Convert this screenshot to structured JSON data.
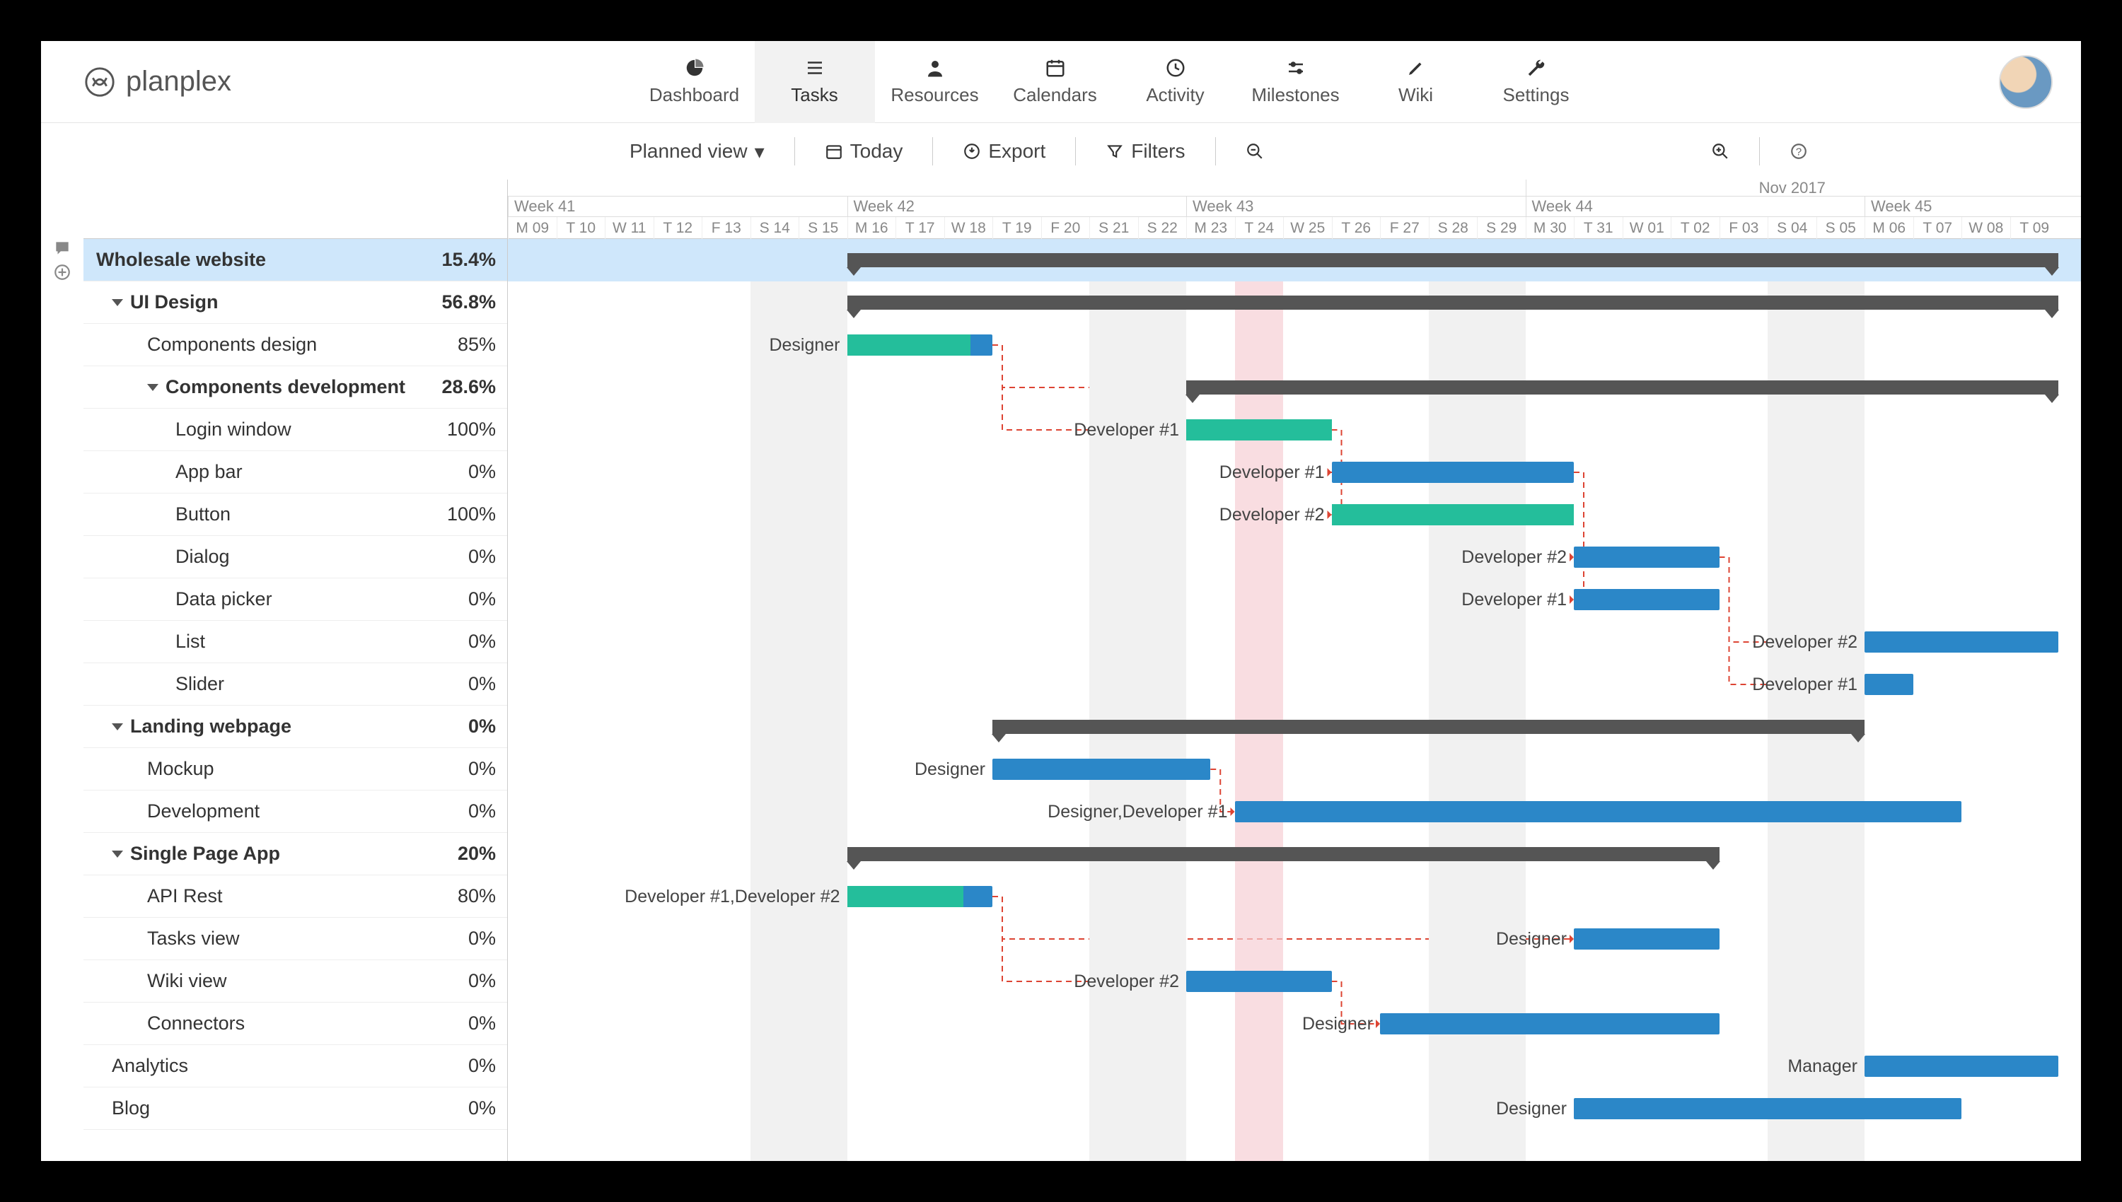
{
  "brand": {
    "name": "planplex"
  },
  "nav": {
    "items": [
      {
        "id": "dashboard",
        "label": "Dashboard",
        "icon": "pie"
      },
      {
        "id": "tasks",
        "label": "Tasks",
        "icon": "list",
        "active": true
      },
      {
        "id": "resources",
        "label": "Resources",
        "icon": "user"
      },
      {
        "id": "calendars",
        "label": "Calendars",
        "icon": "calendar"
      },
      {
        "id": "activity",
        "label": "Activity",
        "icon": "clock"
      },
      {
        "id": "milestones",
        "label": "Milestones",
        "icon": "slider"
      },
      {
        "id": "wiki",
        "label": "Wiki",
        "icon": "pencil"
      },
      {
        "id": "settings",
        "label": "Settings",
        "icon": "wrench"
      }
    ]
  },
  "toolbar": {
    "view_label": "Planned view",
    "today": "Today",
    "export": "Export",
    "filters": "Filters"
  },
  "timeline": {
    "month_right_label": "Nov 2017",
    "month_split": 21,
    "day_width": 68.5,
    "days": [
      "M 09",
      "T 10",
      "W 11",
      "T 12",
      "F 13",
      "S 14",
      "S 15",
      "M 16",
      "T 17",
      "W 18",
      "T 19",
      "F 20",
      "S 21",
      "S 22",
      "M 23",
      "T 24",
      "W 25",
      "T 26",
      "F 27",
      "S 28",
      "S 29",
      "M 30",
      "T 31",
      "W 01",
      "T 02",
      "F 03",
      "S 04",
      "S 05",
      "M 06",
      "T 07",
      "W 08",
      "T 09"
    ],
    "weeks": [
      {
        "label": "Week 41",
        "start": 0
      },
      {
        "label": "Week 42",
        "start": 7
      },
      {
        "label": "Week 43",
        "start": 14
      },
      {
        "label": "Week 44",
        "start": 21
      },
      {
        "label": "Week 45",
        "start": 28
      }
    ],
    "weekend_starts": [
      5,
      12,
      19,
      26
    ],
    "today_index": 15
  },
  "rows": [
    {
      "id": "wholesale",
      "name": "Wholesale website",
      "pct": "15.4%",
      "level": 0,
      "bold": true,
      "selected": true,
      "flag": "",
      "summary": {
        "start": 7,
        "end": 32
      }
    },
    {
      "id": "uidesign",
      "name": "UI Design",
      "pct": "56.8%",
      "level": 1,
      "bold": true,
      "caret": true,
      "summary": {
        "start": 7,
        "end": 32
      }
    },
    {
      "id": "compdes",
      "name": "Components design",
      "pct": "85%",
      "level": 2,
      "flag": "pink",
      "assignee": "Designer",
      "bar": {
        "start": 7,
        "end": 10,
        "progress": 85
      }
    },
    {
      "id": "compdev",
      "name": "Components development",
      "pct": "28.6%",
      "level": 2,
      "bold": true,
      "caret": true,
      "summary": {
        "start": 14,
        "end": 32
      }
    },
    {
      "id": "login",
      "name": "Login window",
      "pct": "100%",
      "level": 3,
      "flag": "green",
      "assignee": "Developer #1",
      "bar": {
        "start": 14,
        "end": 17,
        "progress": 100
      }
    },
    {
      "id": "appbar",
      "name": "App bar",
      "pct": "0%",
      "level": 3,
      "assignee": "Developer #1",
      "bar": {
        "start": 17,
        "end": 22,
        "progress": 0
      }
    },
    {
      "id": "button",
      "name": "Button",
      "pct": "100%",
      "level": 3,
      "flag": "green",
      "assignee": "Developer #2",
      "bar": {
        "start": 17,
        "end": 22,
        "progress": 100
      }
    },
    {
      "id": "dialog",
      "name": "Dialog",
      "pct": "0%",
      "level": 3,
      "assignee": "Developer #2",
      "bar": {
        "start": 22,
        "end": 25,
        "progress": 0
      }
    },
    {
      "id": "datapick",
      "name": "Data picker",
      "pct": "0%",
      "level": 3,
      "assignee": "Developer #1",
      "bar": {
        "start": 22,
        "end": 25,
        "progress": 0
      }
    },
    {
      "id": "list",
      "name": "List",
      "pct": "0%",
      "level": 3,
      "assignee": "Developer #2",
      "bar": {
        "start": 28,
        "end": 32,
        "progress": 0
      }
    },
    {
      "id": "slider",
      "name": "Slider",
      "pct": "0%",
      "level": 3,
      "assignee": "Developer #1",
      "bar": {
        "start": 28,
        "end": 29,
        "progress": 0
      }
    },
    {
      "id": "landing",
      "name": "Landing webpage",
      "pct": "0%",
      "level": 1,
      "bold": true,
      "caret": true,
      "summary": {
        "start": 10,
        "end": 28
      }
    },
    {
      "id": "mockup",
      "name": "Mockup",
      "pct": "0%",
      "level": 2,
      "assignee": "Designer",
      "bar": {
        "start": 10,
        "end": 14.5,
        "progress": 0
      }
    },
    {
      "id": "devland",
      "name": "Development",
      "pct": "0%",
      "level": 2,
      "assignee": "Designer,Developer #1",
      "bar": {
        "start": 15,
        "end": 30,
        "progress": 0
      }
    },
    {
      "id": "spa",
      "name": "Single Page App",
      "pct": "20%",
      "level": 1,
      "bold": true,
      "caret": true,
      "summary": {
        "start": 7,
        "end": 25
      }
    },
    {
      "id": "apirest",
      "name": "API Rest",
      "pct": "80%",
      "level": 2,
      "flag": "pink",
      "assignee": "Developer #1,Developer #2",
      "bar": {
        "start": 7,
        "end": 10,
        "progress": 80
      }
    },
    {
      "id": "tasksview",
      "name": "Tasks view",
      "pct": "0%",
      "level": 2,
      "assignee": "Designer",
      "bar": {
        "start": 22,
        "end": 25,
        "progress": 0
      }
    },
    {
      "id": "wikiview",
      "name": "Wiki view",
      "pct": "0%",
      "level": 2,
      "assignee": "Developer #2",
      "bar": {
        "start": 14,
        "end": 17,
        "progress": 0
      }
    },
    {
      "id": "connectors",
      "name": "Connectors",
      "pct": "0%",
      "level": 2,
      "assignee": "Designer",
      "bar": {
        "start": 18,
        "end": 25,
        "progress": 0
      }
    },
    {
      "id": "analytics",
      "name": "Analytics",
      "pct": "0%",
      "level": 1,
      "assignee": "Manager",
      "bar": {
        "start": 28,
        "end": 32,
        "progress": 0
      }
    },
    {
      "id": "blog",
      "name": "Blog",
      "pct": "0%",
      "level": 1,
      "assignee": "Designer",
      "bar": {
        "start": 22,
        "end": 30,
        "progress": 0
      }
    }
  ],
  "dependencies": [
    {
      "from": "compdes",
      "to": "login"
    },
    {
      "from": "compdes",
      "to": "compdev"
    },
    {
      "from": "login",
      "to": "appbar"
    },
    {
      "from": "login",
      "to": "button"
    },
    {
      "from": "appbar",
      "to": "dialog"
    },
    {
      "from": "appbar",
      "to": "datapick"
    },
    {
      "from": "dialog",
      "to": "list"
    },
    {
      "from": "dialog",
      "to": "slider"
    },
    {
      "from": "mockup",
      "to": "devland"
    },
    {
      "from": "apirest",
      "to": "wikiview"
    },
    {
      "from": "apirest",
      "to": "tasksview"
    },
    {
      "from": "wikiview",
      "to": "connectors"
    }
  ],
  "chart_data": {
    "type": "gantt",
    "title": "Wholesale website — Planned view",
    "date_range": {
      "start": "2017-10-09",
      "end": "2017-11-09"
    },
    "axis_days": [
      "2017-10-09",
      "2017-10-10",
      "2017-10-11",
      "2017-10-12",
      "2017-10-13",
      "2017-10-14",
      "2017-10-15",
      "2017-10-16",
      "2017-10-17",
      "2017-10-18",
      "2017-10-19",
      "2017-10-20",
      "2017-10-21",
      "2017-10-22",
      "2017-10-23",
      "2017-10-24",
      "2017-10-25",
      "2017-10-26",
      "2017-10-27",
      "2017-10-28",
      "2017-10-29",
      "2017-10-30",
      "2017-10-31",
      "2017-11-01",
      "2017-11-02",
      "2017-11-03",
      "2017-11-04",
      "2017-11-05",
      "2017-11-06",
      "2017-11-07",
      "2017-11-08",
      "2017-11-09"
    ],
    "today": "2017-10-24",
    "tasks": [
      {
        "id": "wholesale",
        "name": "Wholesale website",
        "type": "summary",
        "start": "2017-10-16",
        "end": "2017-11-09",
        "progress": 15.4
      },
      {
        "id": "uidesign",
        "name": "UI Design",
        "parent": "wholesale",
        "type": "summary",
        "start": "2017-10-16",
        "end": "2017-11-09",
        "progress": 56.8
      },
      {
        "id": "compdes",
        "name": "Components design",
        "parent": "uidesign",
        "start": "2017-10-16",
        "end": "2017-10-19",
        "progress": 85,
        "assignees": [
          "Designer"
        ]
      },
      {
        "id": "compdev",
        "name": "Components development",
        "parent": "uidesign",
        "type": "summary",
        "start": "2017-10-23",
        "end": "2017-11-09",
        "progress": 28.6
      },
      {
        "id": "login",
        "name": "Login window",
        "parent": "compdev",
        "start": "2017-10-23",
        "end": "2017-10-26",
        "progress": 100,
        "assignees": [
          "Developer #1"
        ]
      },
      {
        "id": "appbar",
        "name": "App bar",
        "parent": "compdev",
        "start": "2017-10-26",
        "end": "2017-10-31",
        "progress": 0,
        "assignees": [
          "Developer #1"
        ]
      },
      {
        "id": "button",
        "name": "Button",
        "parent": "compdev",
        "start": "2017-10-26",
        "end": "2017-10-31",
        "progress": 100,
        "assignees": [
          "Developer #2"
        ]
      },
      {
        "id": "dialog",
        "name": "Dialog",
        "parent": "compdev",
        "start": "2017-10-31",
        "end": "2017-11-03",
        "progress": 0,
        "assignees": [
          "Developer #2"
        ]
      },
      {
        "id": "datapick",
        "name": "Data picker",
        "parent": "compdev",
        "start": "2017-10-31",
        "end": "2017-11-03",
        "progress": 0,
        "assignees": [
          "Developer #1"
        ]
      },
      {
        "id": "list",
        "name": "List",
        "parent": "compdev",
        "start": "2017-11-06",
        "end": "2017-11-09",
        "progress": 0,
        "assignees": [
          "Developer #2"
        ]
      },
      {
        "id": "slider",
        "name": "Slider",
        "parent": "compdev",
        "start": "2017-11-06",
        "end": "2017-11-07",
        "progress": 0,
        "assignees": [
          "Developer #1"
        ]
      },
      {
        "id": "landing",
        "name": "Landing webpage",
        "parent": "wholesale",
        "type": "summary",
        "start": "2017-10-19",
        "end": "2017-11-06",
        "progress": 0
      },
      {
        "id": "mockup",
        "name": "Mockup",
        "parent": "landing",
        "start": "2017-10-19",
        "end": "2017-10-23",
        "progress": 0,
        "assignees": [
          "Designer"
        ]
      },
      {
        "id": "devland",
        "name": "Development",
        "parent": "landing",
        "start": "2017-10-24",
        "end": "2017-11-08",
        "progress": 0,
        "assignees": [
          "Designer",
          "Developer #1"
        ]
      },
      {
        "id": "spa",
        "name": "Single Page App",
        "parent": "wholesale",
        "type": "summary",
        "start": "2017-10-16",
        "end": "2017-11-03",
        "progress": 20
      },
      {
        "id": "apirest",
        "name": "API Rest",
        "parent": "spa",
        "start": "2017-10-16",
        "end": "2017-10-19",
        "progress": 80,
        "assignees": [
          "Developer #1",
          "Developer #2"
        ]
      },
      {
        "id": "tasksview",
        "name": "Tasks view",
        "parent": "spa",
        "start": "2017-10-31",
        "end": "2017-11-03",
        "progress": 0,
        "assignees": [
          "Designer"
        ]
      },
      {
        "id": "wikiview",
        "name": "Wiki view",
        "parent": "spa",
        "start": "2017-10-23",
        "end": "2017-10-26",
        "progress": 0,
        "assignees": [
          "Developer #2"
        ]
      },
      {
        "id": "connectors",
        "name": "Connectors",
        "parent": "spa",
        "start": "2017-10-27",
        "end": "2017-11-03",
        "progress": 0,
        "assignees": [
          "Designer"
        ]
      },
      {
        "id": "analytics",
        "name": "Analytics",
        "parent": "wholesale",
        "start": "2017-11-06",
        "end": "2017-11-09",
        "progress": 0,
        "assignees": [
          "Manager"
        ]
      },
      {
        "id": "blog",
        "name": "Blog",
        "parent": "wholesale",
        "start": "2017-10-31",
        "end": "2017-11-08",
        "progress": 0,
        "assignees": [
          "Designer"
        ]
      }
    ],
    "dependencies": [
      [
        "compdes",
        "compdev"
      ],
      [
        "compdes",
        "login"
      ],
      [
        "login",
        "appbar"
      ],
      [
        "login",
        "button"
      ],
      [
        "appbar",
        "dialog"
      ],
      [
        "appbar",
        "datapick"
      ],
      [
        "dialog",
        "list"
      ],
      [
        "dialog",
        "slider"
      ],
      [
        "mockup",
        "devland"
      ],
      [
        "apirest",
        "wikiview"
      ],
      [
        "apirest",
        "tasksview"
      ],
      [
        "wikiview",
        "connectors"
      ]
    ]
  }
}
